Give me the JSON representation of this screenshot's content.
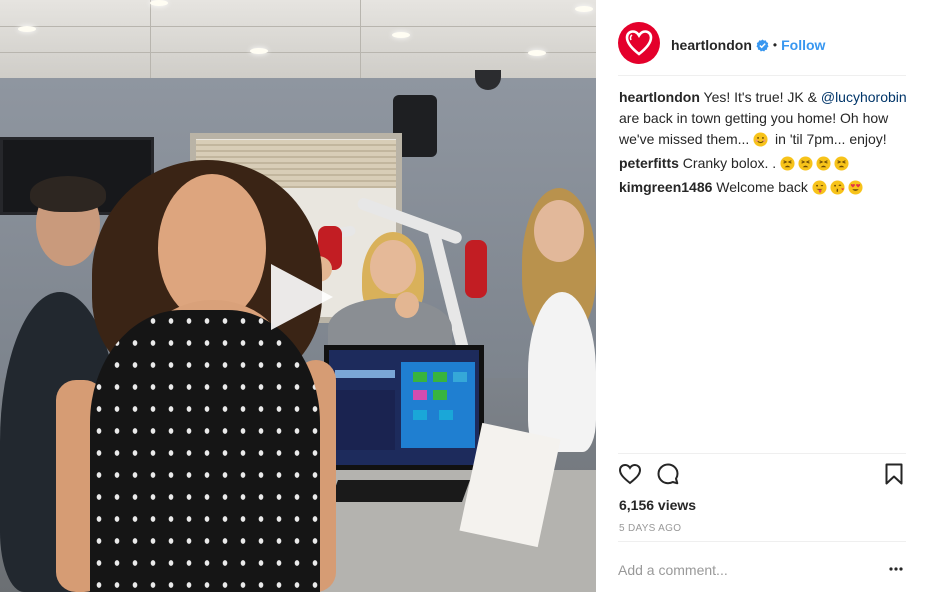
{
  "post": {
    "username": "heartlondon",
    "separator": "•",
    "follow_label": "Follow",
    "verified_icon": "verified-badge-icon",
    "avatar_icon": "heart-logo-icon"
  },
  "comments": [
    {
      "user": "heartlondon",
      "text_before": "Yes! It's true! JK & ",
      "mention": "@lucyhorobin",
      "text_after": " are back in town getting you home! Oh how we've missed them...",
      "text_tail": " in 'til 7pm... enjoy!",
      "emojis": [
        "smiling-face-icon"
      ]
    },
    {
      "user": "peterfitts",
      "text": "Cranky bolox. . ",
      "emojis": [
        "tired-face-icon",
        "tired-face-icon",
        "tired-face-icon",
        "tired-face-icon"
      ]
    },
    {
      "user": "kimgreen1486",
      "text": "Welcome back ",
      "emojis": [
        "tongue-out-face-icon",
        "kissing-face-icon",
        "heart-eyes-face-icon"
      ]
    }
  ],
  "stats": {
    "views": "6,156 views",
    "time": "5 DAYS AGO"
  },
  "comment_box": {
    "placeholder": "Add a comment..."
  },
  "colors": {
    "link": "#3897f0",
    "brand": "#e4002b",
    "text": "#262626",
    "muted": "#999999"
  }
}
